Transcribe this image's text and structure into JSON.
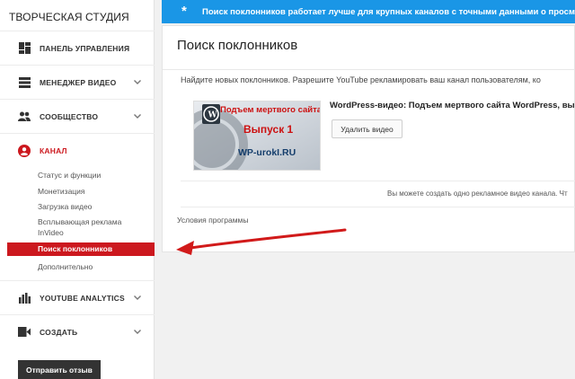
{
  "sidebar": {
    "studio_title": "ТВОРЧЕСКАЯ СТУДИЯ",
    "nav": [
      {
        "label": "ПАНЕЛЬ УПРАВЛЕНИЯ",
        "icon": "dashboard-icon"
      },
      {
        "label": "МЕНЕДЖЕР ВИДЕО",
        "icon": "video-manager-icon"
      },
      {
        "label": "СООБЩЕСТВО",
        "icon": "community-icon"
      },
      {
        "label": "КАНАЛ",
        "icon": "channel-icon"
      },
      {
        "label": "YOUTUBE ANALYTICS",
        "icon": "analytics-icon"
      },
      {
        "label": "СОЗДАТЬ",
        "icon": "create-icon"
      }
    ],
    "channel_sub": [
      "Статус и функции",
      "Монетизация",
      "Загрузка видео",
      "Всплывающая реклама",
      "InVideo",
      "Поиск поклонников",
      "Дополнительно"
    ],
    "feedback_label": "Отправить отзыв"
  },
  "banner": {
    "text": "Поиск поклонников работает лучше для крупных каналов с точными данными о просм"
  },
  "main": {
    "title": "Поиск поклонников",
    "intro": "Найдите новых поклонников. Разрешите YouTube рекламировать ваш канал пользователям, ко",
    "thumbnail": {
      "line1": "Подъем мертвого сайта",
      "line2": "Выпуск 1",
      "line3": "WP-urokI.RU"
    },
    "video_title": "WordPress-видео: Подъем мертвого сайта WordPress, вы",
    "delete_label": "Удалить видео",
    "note": "Вы можете создать одно рекламное видео канала. Чт",
    "terms": "Условия программы"
  },
  "colors": {
    "accent_red": "#cc181e",
    "banner_blue": "#1a96e6"
  }
}
